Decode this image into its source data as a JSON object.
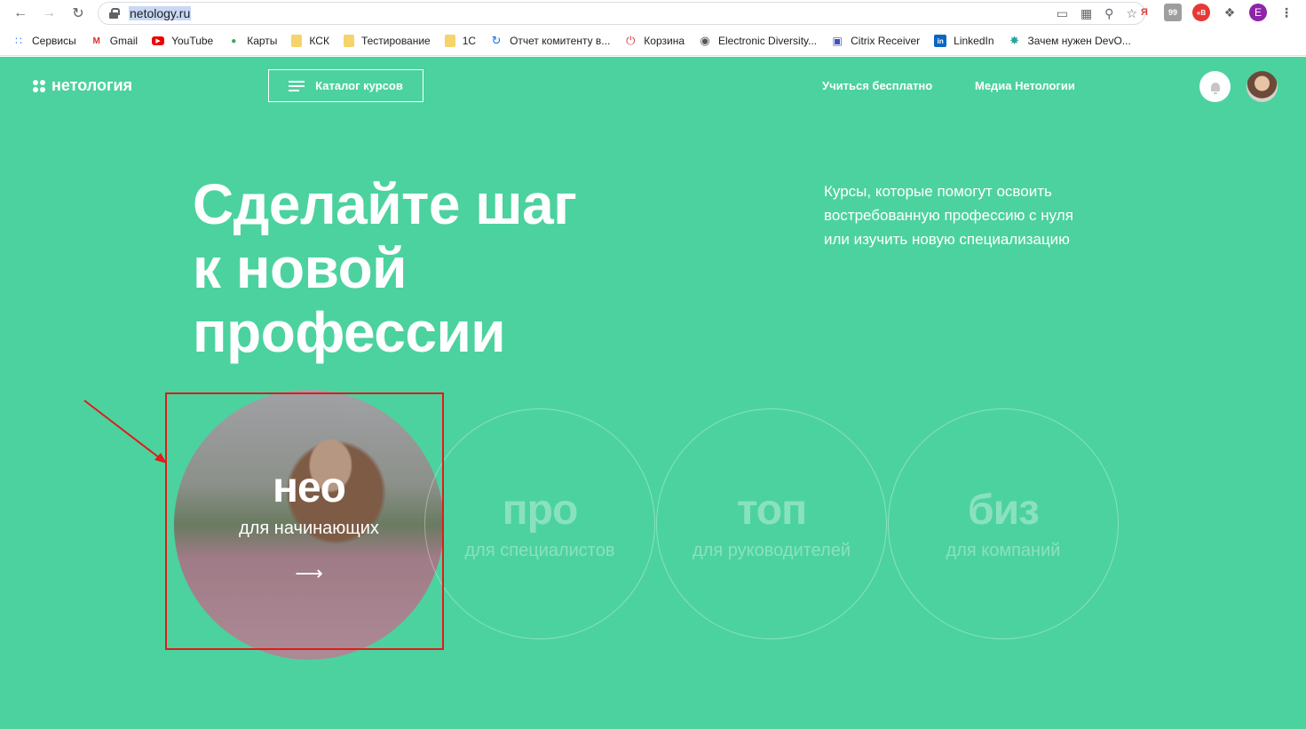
{
  "browser": {
    "url": "netology.ru",
    "bookmarks": [
      {
        "label": "Сервисы",
        "icon": "apps-grid-icon"
      },
      {
        "label": "Gmail",
        "icon": "gmail-icon"
      },
      {
        "label": "YouTube",
        "icon": "youtube-icon"
      },
      {
        "label": "Карты",
        "icon": "maps-pin-icon"
      },
      {
        "label": "КСК",
        "icon": "folder-icon"
      },
      {
        "label": "Тестирование",
        "icon": "folder-icon"
      },
      {
        "label": "1С",
        "icon": "folder-icon"
      },
      {
        "label": "Отчет комитенту в...",
        "icon": "refresh-icon"
      },
      {
        "label": "Корзина",
        "icon": "power-icon"
      },
      {
        "label": "Electronic Diversity...",
        "icon": "globe-icon"
      },
      {
        "label": "Citrix Receiver",
        "icon": "citrix-icon"
      },
      {
        "label": "LinkedIn",
        "icon": "linkedin-icon"
      },
      {
        "label": "Зачем нужен DevO...",
        "icon": "star-burst-icon"
      }
    ],
    "profile_letter": "E"
  },
  "header": {
    "logo": "нетология",
    "catalog_label": "Каталог курсов",
    "link_free": "Учиться бесплатно",
    "link_media": "Медиа Нетологии"
  },
  "hero": {
    "title_line1": "Сделайте шаг",
    "title_line2": "к новой",
    "title_line3": "профессии",
    "subtitle_line1": "Курсы, которые помогут освоить",
    "subtitle_line2": "востребованную профессию с нуля",
    "subtitle_line3": "или изучить новую специализацию"
  },
  "levels": [
    {
      "title": "нео",
      "caption": "для начинающих"
    },
    {
      "title": "про",
      "caption": "для специалистов"
    },
    {
      "title": "топ",
      "caption": "для руководителей"
    },
    {
      "title": "биз",
      "caption": "для компаний"
    }
  ],
  "colors": {
    "brand_green": "#4cd29f",
    "annotation_red": "#e11b1b"
  }
}
